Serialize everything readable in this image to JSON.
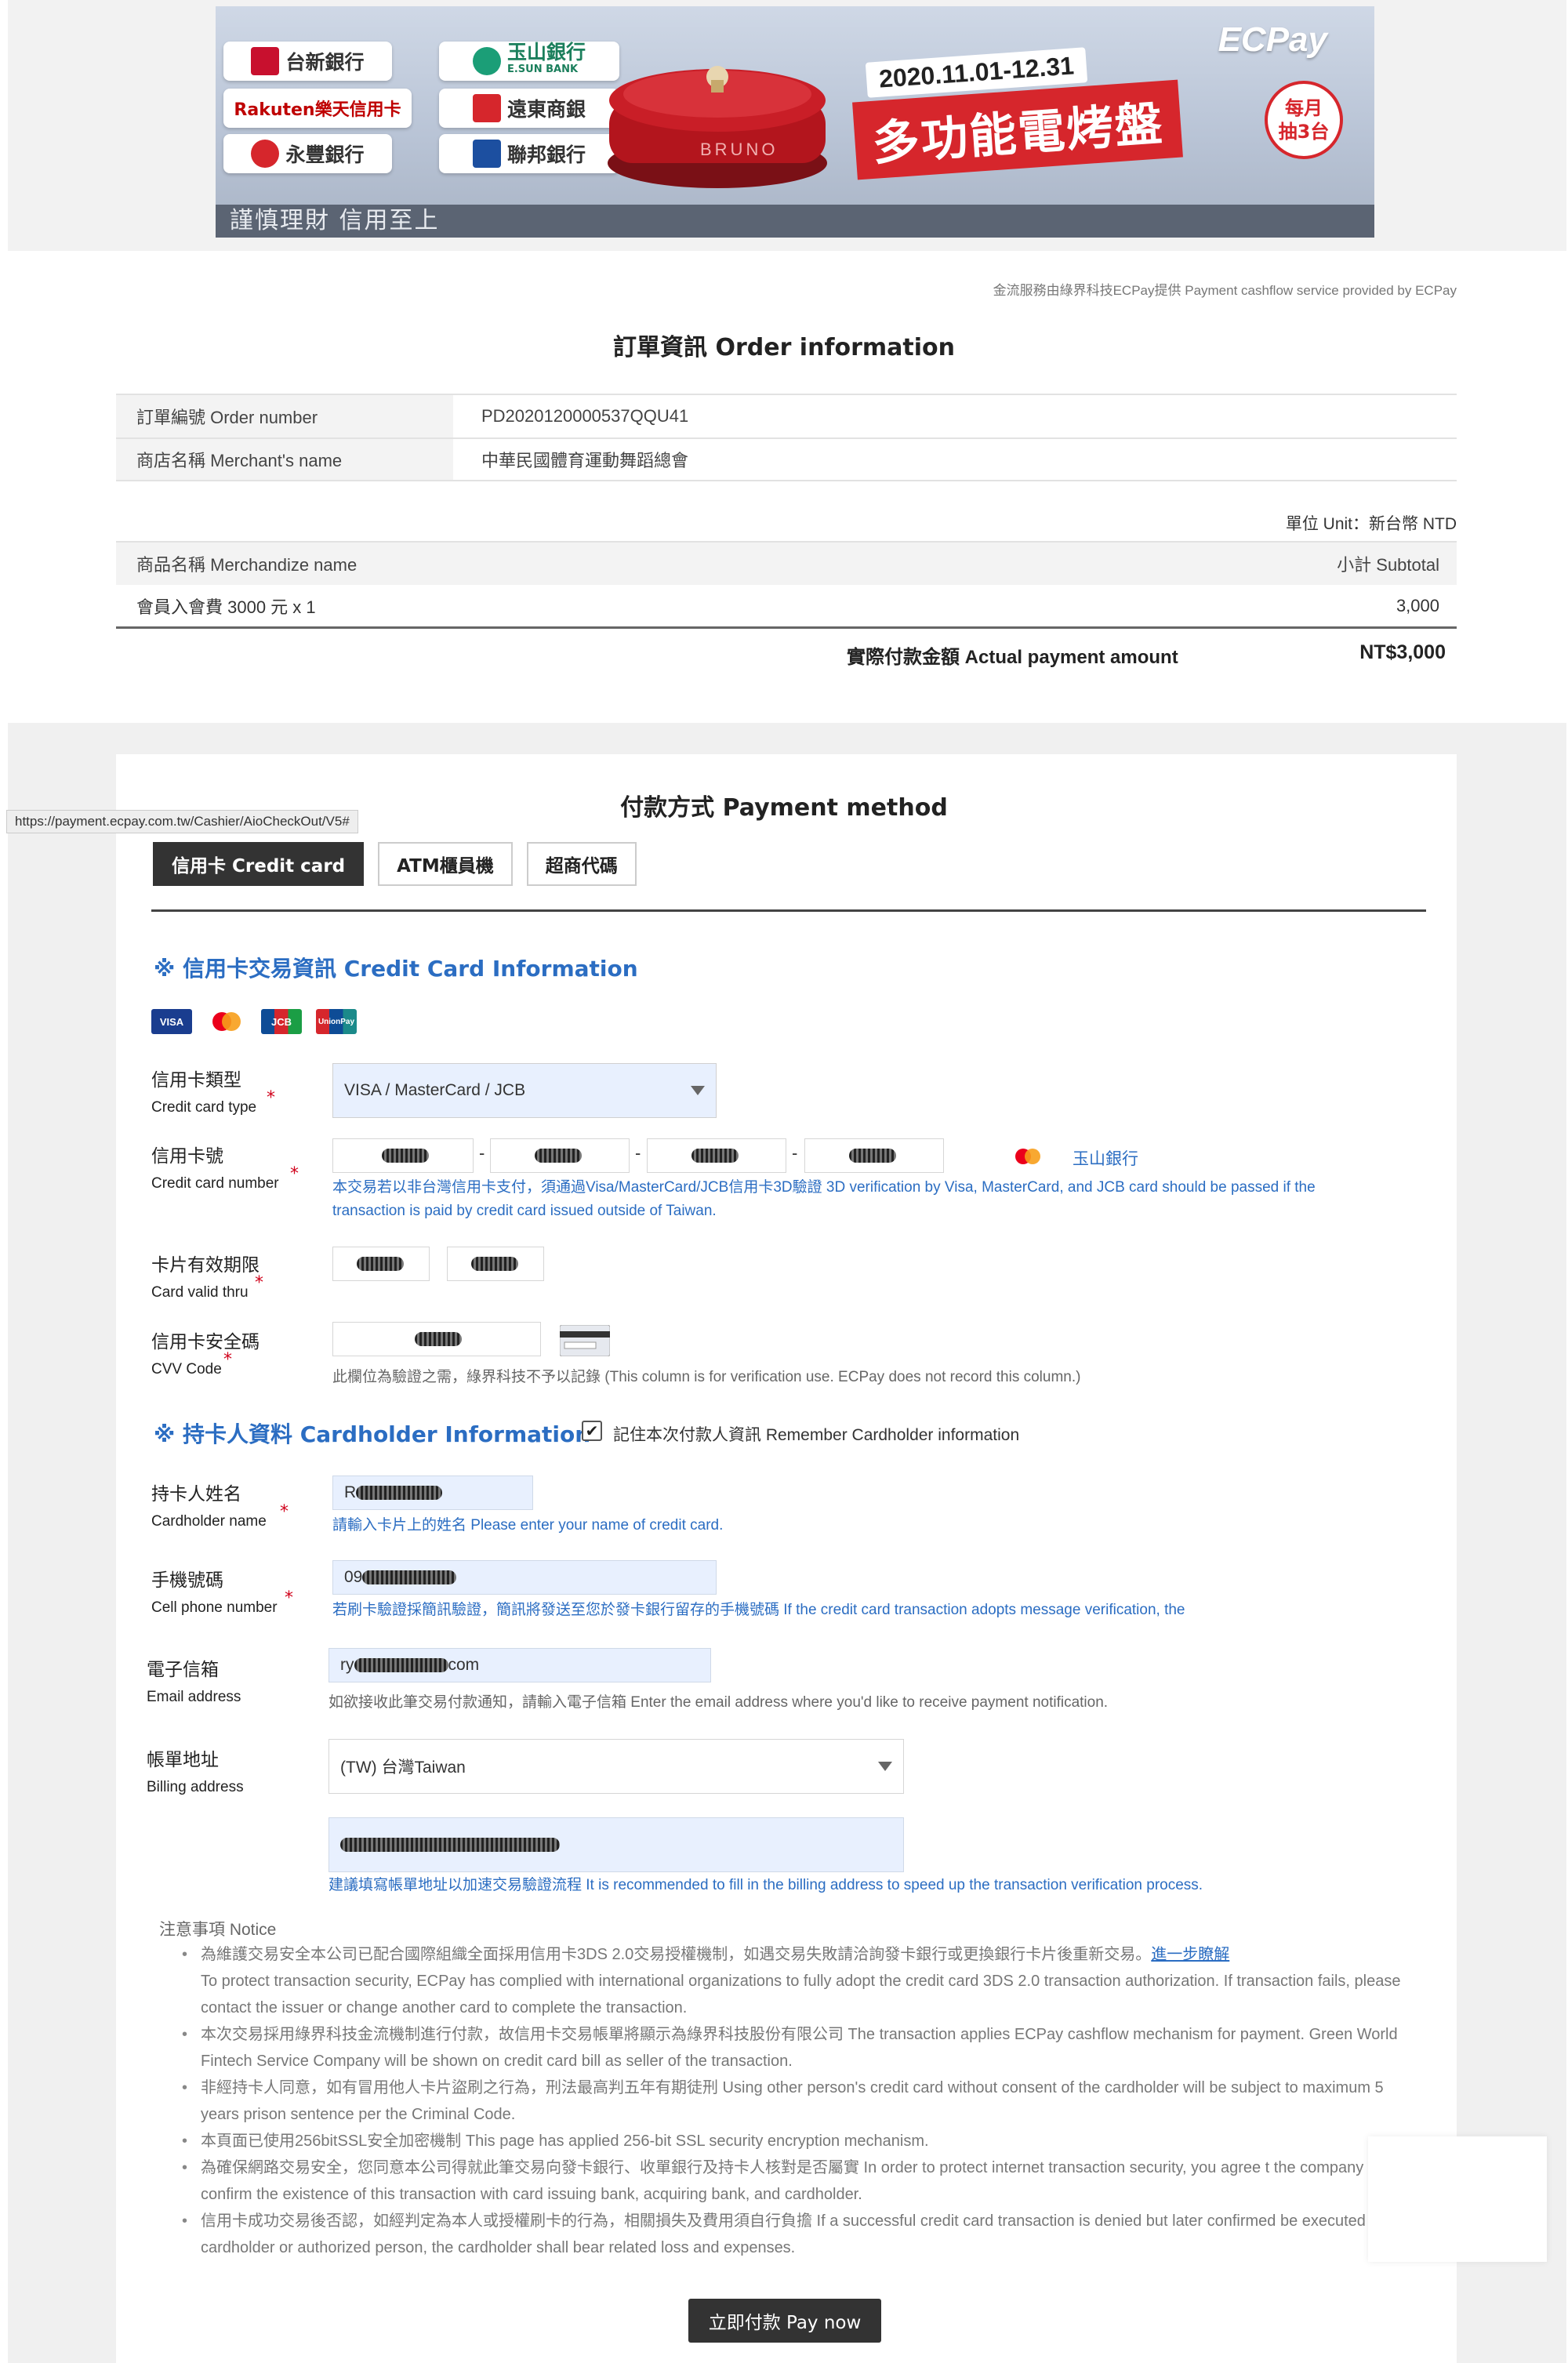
{
  "banner": {
    "banks": [
      "台新銀行",
      "玉山銀行",
      "Rakuten樂天信用卡",
      "遠東商銀",
      "永豐銀行",
      "聯邦銀行"
    ],
    "esun_sub": "E.SUN BANK",
    "promo_date": "2020.11.01-12.31",
    "promo_title": "多功能電烤盤",
    "promo_brand": "ECPay",
    "promo_badge_line1": "每月",
    "promo_badge_line2": "抽3台",
    "product_brand": "BRUNO",
    "footer_slogan": "謹慎理財  信用至上"
  },
  "provider_note": "金流服務由綠界科技ECPay提供 Payment cashflow service provided by ECPay",
  "order": {
    "title": "訂單資訊 Order information",
    "rows": [
      {
        "label": "訂單編號 Order number",
        "value": "PD2020120000537QQU41"
      },
      {
        "label": "商店名稱 Merchant's name",
        "value": "中華民國體育運動舞蹈總會"
      }
    ],
    "unit": "單位 Unit：新台幣 NTD",
    "merch_header": "商品名稱 Merchandize name",
    "subtotal_header": "小計 Subtotal",
    "item": "會員入會費 3000 元 x 1",
    "item_subtotal": "3,000",
    "actual_label": "實際付款金額 Actual payment amount",
    "actual_amount": "NT$3,000"
  },
  "payment": {
    "title": "付款方式 Payment method",
    "url_tooltip": "https://payment.ecpay.com.tw/Cashier/AioCheckOut/V5#",
    "tabs": [
      "信用卡 Credit card",
      "ATM櫃員機",
      "超商代碼"
    ],
    "cc_section": "※ 信用卡交易資訊 Credit Card Information",
    "card_brands": [
      "VISA",
      "MC",
      "JCB",
      "UnionPay"
    ],
    "card_type": {
      "label": "信用卡類型",
      "label_en": "Credit card type",
      "value": "VISA / MasterCard / JCB"
    },
    "card_number": {
      "label": "信用卡號",
      "label_en": "Credit card number",
      "issuer": "玉山銀行",
      "hint": "本交易若以非台灣信用卡支付，須通過Visa/MasterCard/JCB信用卡3D驗證 3D verification by Visa, MasterCard, and JCB card should be passed if the transaction is paid by credit card issued outside of Taiwan."
    },
    "valid_thru": {
      "label": "卡片有效期限",
      "label_en": "Card valid thru"
    },
    "cvv": {
      "label": "信用卡安全碼",
      "label_en": "CVV Code",
      "hint": "此欄位為驗證之需，綠界科技不予以記錄 (This column is for verification use. ECPay does not record this column.)"
    },
    "holder_section": "※ 持卡人資料 Cardholder Information",
    "remember": "記住本次付款人資訊 Remember Cardholder information",
    "holder_name": {
      "label": "持卡人姓名",
      "label_en": "Cardholder name",
      "value_prefix": "R",
      "hint": "請輸入卡片上的姓名 Please enter your name of credit card."
    },
    "phone": {
      "label": "手機號碼",
      "label_en": "Cell phone number",
      "value_prefix": "09",
      "hint": "若刷卡驗證採簡訊驗證，簡訊將發送至您於發卡銀行留存的手機號碼 If the credit card transaction adopts message verification, the"
    },
    "email": {
      "label": "電子信箱",
      "label_en": "Email address",
      "value_prefix": "ry",
      "value_suffix": "com",
      "hint": "如欲接收此筆交易付款通知，請輸入電子信箱 Enter the email address where you'd like to receive payment notification."
    },
    "billing": {
      "label": "帳單地址",
      "label_en": "Billing address",
      "value": "(TW) 台灣Taiwan",
      "hint": "建議填寫帳單地址以加速交易驗證流程 It is recommended to fill in the billing address to speed up the transaction verification process."
    },
    "notice_title": "注意事項 Notice",
    "notice_link": "進一步瞭解",
    "notices": [
      "為維護交易安全本公司已配合國際組織全面採用信用卡3DS 2.0交易授權機制，如遇交易失敗請洽詢發卡銀行或更換銀行卡片後重新交易。",
      "本次交易採用綠界科技金流機制進行付款，故信用卡交易帳單將顯示為綠界科技股份有限公司 The transaction applies ECPay cashflow mechanism for payment. Green World Fintech Service Company will be shown on credit card bill as seller of the transaction.",
      "非經持卡人同意，如有冒用他人卡片盜刷之行為，刑法最高判五年有期徒刑 Using other person's credit card without consent of the cardholder will be subject to maximum 5 years prison sentence per the Criminal Code.",
      "本頁面已使用256bitSSL安全加密機制 This page has applied 256-bit SSL security encryption mechanism.",
      "為確保網路交易安全，您同意本公司得就此筆交易向發卡銀行、收單銀行及持卡人核對是否屬實 In order to protect internet transaction security, you agree t the company may confirm the existence of this transaction with card issuing bank, acquiring bank, and cardholder.",
      "信用卡成功交易後否認，如經判定為本人或授權刷卡的行為，相關損失及費用須自行負擔 If a successful credit card transaction is denied but later confirmed be executed by cardholder or authorized person, the cardholder shall bear related loss and expenses."
    ],
    "notice_1_en": "To protect transaction security, ECPay has complied with international organizations to fully adopt the credit card 3DS 2.0 transaction authorization. If transaction fails, please contact the issuer or change another card to complete the transaction.",
    "pay_button": "立即付款 Pay now"
  },
  "colors": {
    "accent": "#2b6dc2",
    "field_bg": "#e8f0fe",
    "dark": "#333333",
    "required": "#d0021b"
  }
}
